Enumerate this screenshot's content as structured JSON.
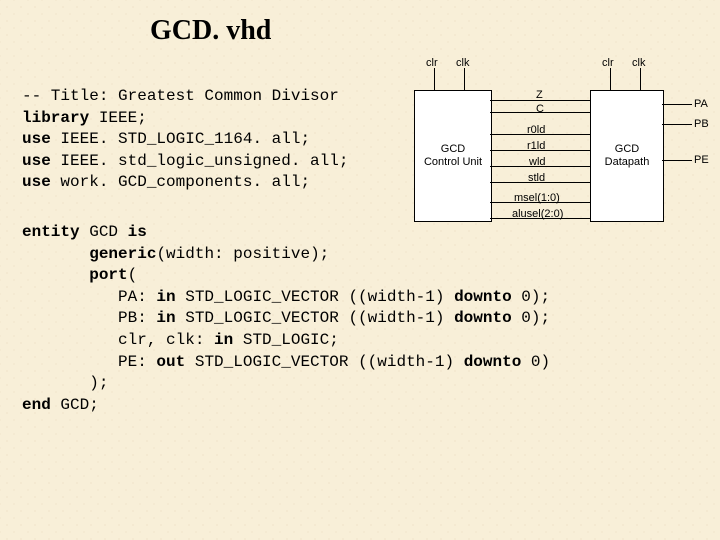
{
  "title": "GCD. vhd",
  "code1": {
    "l1a": "-- Title: Greatest Common Divisor",
    "l2a": "library",
    "l2b": " IEEE;",
    "l3a": "use",
    "l3b": " IEEE. STD_LOGIC_1164. all;",
    "l4a": "use",
    "l4b": " IEEE. std_logic_unsigned. all;",
    "l5a": "use",
    "l5b": " work. GCD_components. all;"
  },
  "code2": {
    "l1a": "entity",
    "l1b": " GCD ",
    "l1c": "is",
    "l2a": "       ",
    "l2b": "generic",
    "l2c": "(width: positive);",
    "l3a": "       ",
    "l3b": "port",
    "l3c": "(",
    "l4a": "          PA: ",
    "l4b": "in",
    "l4c": " STD_LOGIC_VECTOR ((width-1) ",
    "l4d": "downto",
    "l4e": " 0);",
    "l5a": "          PB: ",
    "l5b": "in",
    "l5c": " STD_LOGIC_VECTOR ((width-1) ",
    "l5d": "downto",
    "l5e": " 0);",
    "l6a": "          clr, clk: ",
    "l6b": "in",
    "l6c": " STD_LOGIC;",
    "l7a": "          PE: ",
    "l7b": "out",
    "l7c": " STD_LOGIC_VECTOR ((width-1) ",
    "l7d": "downto",
    "l7e": " 0)",
    "l8a": "       );",
    "l9a": "end",
    "l9b": " GCD;"
  },
  "diagram": {
    "box1a": "GCD",
    "box1b": "Control Unit",
    "box2a": "GCD",
    "box2b": "Datapath",
    "clk": "clk",
    "clr": "clr",
    "Z": "Z",
    "C": "C",
    "r0ld": "r0ld",
    "r1ld": "r1ld",
    "wld": "wld",
    "stld": "stld",
    "msel": "msel(1:0)",
    "alusel": "alusel(2:0)",
    "PA": "PA",
    "PB": "PB",
    "PE": "PE"
  }
}
